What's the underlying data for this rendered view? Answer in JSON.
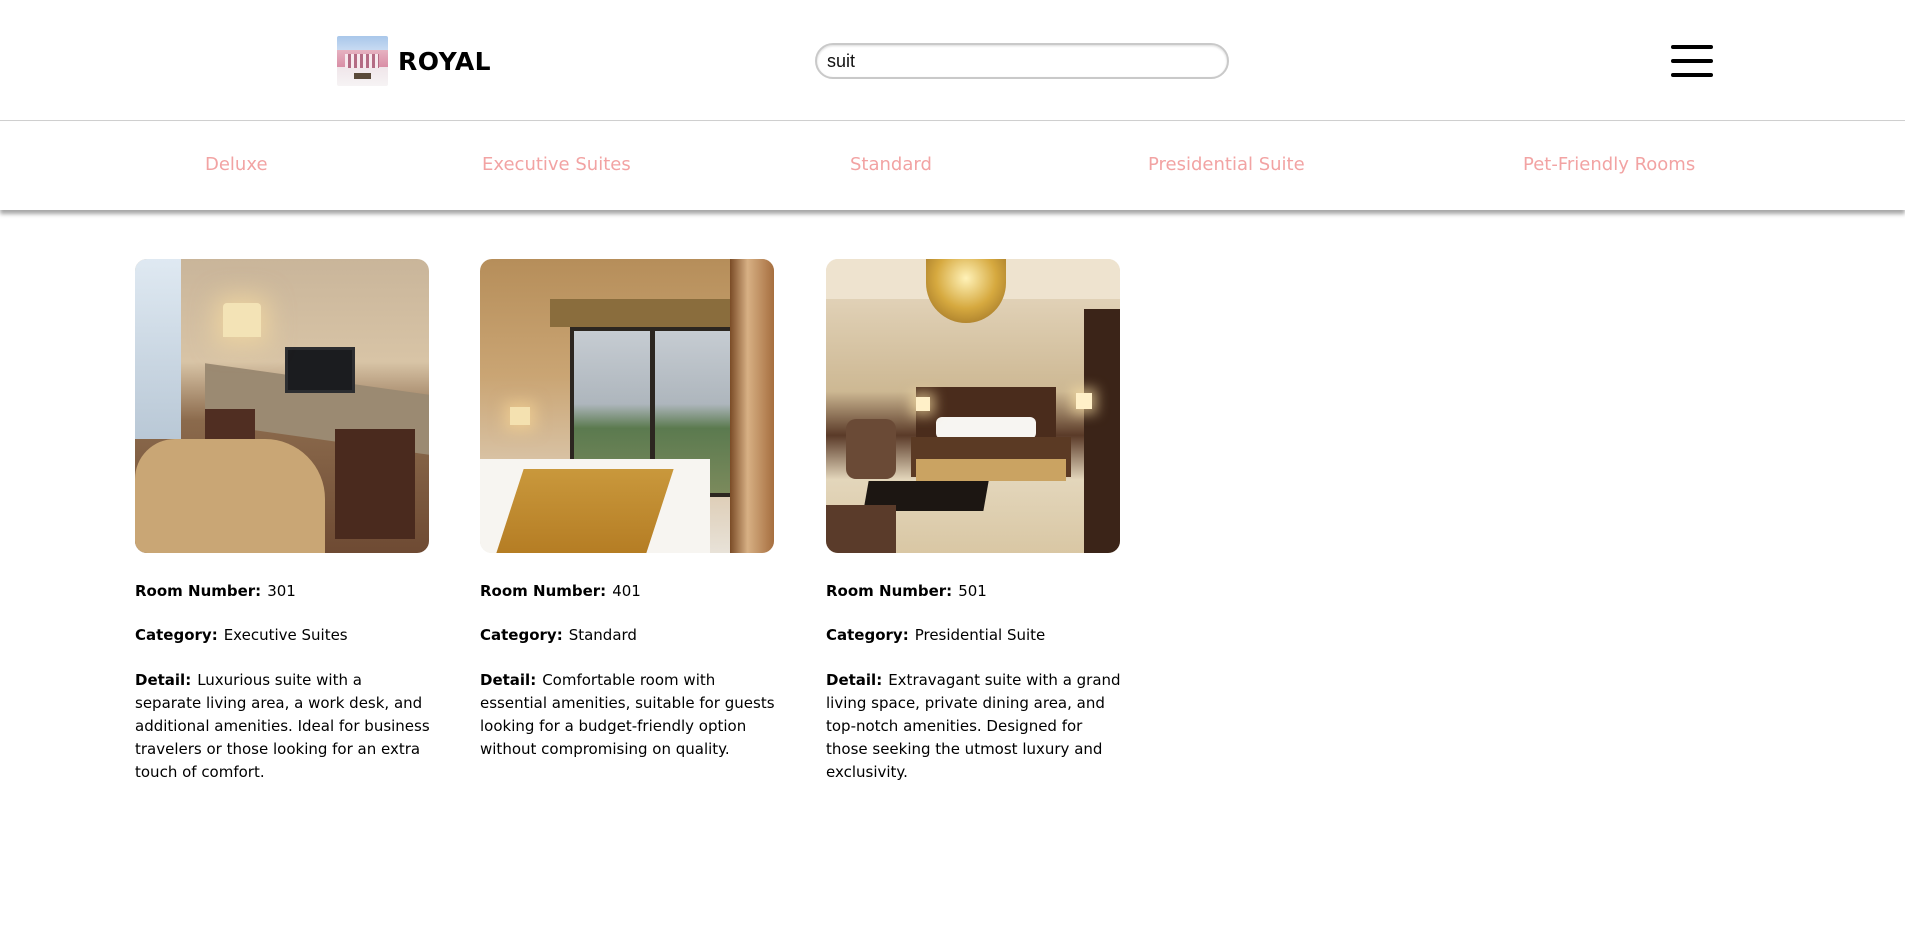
{
  "header": {
    "brand_name": "ROYAL",
    "logo_icon": "hotel-logo",
    "search": {
      "value": "suit",
      "placeholder": ""
    },
    "menu_icon": "hamburger-menu-icon"
  },
  "categories": [
    "Deluxe",
    "Executive Suites",
    "Standard",
    "Presidential Suite",
    "Pet-Friendly Rooms"
  ],
  "labels": {
    "room_number": "Room Number:",
    "category": "Category:",
    "detail": "Detail:"
  },
  "rooms": [
    {
      "room_number": "301",
      "category": "Executive Suites",
      "detail": "Luxurious suite with a separate living area, a work desk, and additional amenities. Ideal for business travelers or those looking for an extra touch of comfort."
    },
    {
      "room_number": "401",
      "category": "Standard",
      "detail": "Comfortable room with essential amenities, suitable for guests looking for a budget-friendly option without compromising on quality."
    },
    {
      "room_number": "501",
      "category": "Presidential Suite",
      "detail": "Extravagant suite with a grand living space, private dining area, and top-notch amenities. Designed for those seeking the utmost luxury and exclusivity."
    }
  ],
  "colors": {
    "category_link": "#f2a3a3",
    "text": "#000000",
    "background": "#ffffff"
  }
}
